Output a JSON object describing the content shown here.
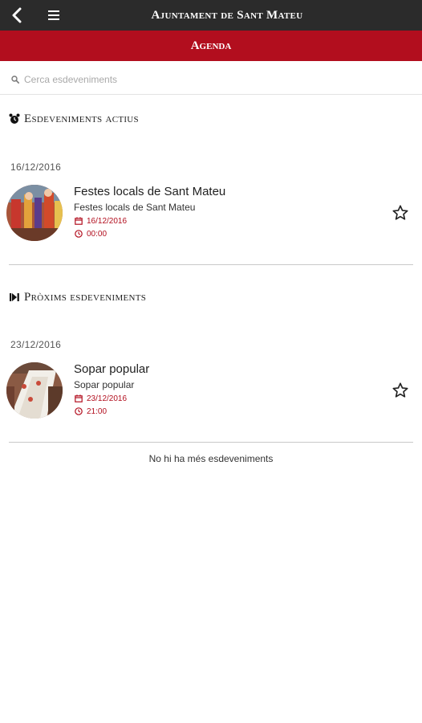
{
  "header": {
    "title": "Ajuntament de Sant Mateu",
    "section": "Agenda",
    "back_icon": "chevron-left-icon",
    "menu_icon": "hamburger-menu-icon"
  },
  "colors": {
    "topbar": "#2b2b2b",
    "accent": "#b20e1e"
  },
  "search": {
    "placeholder": "Cerca esdeveniments",
    "value": ""
  },
  "groups": [
    {
      "title": "Esdeveniments actius",
      "icon": "alarm-clock-icon",
      "date": "16/12/2016",
      "events": [
        {
          "title": "Festes locals de Sant Mateu",
          "subtitle": "Festes locals de Sant Mateu",
          "date": "16/12/2016",
          "time": "00:00",
          "image": "festival-photo",
          "starred": false
        }
      ]
    },
    {
      "title": "Pròxims esdeveniments",
      "icon": "next-track-icon",
      "date": "23/12/2016",
      "events": [
        {
          "title": "Sopar popular",
          "subtitle": "Sopar popular",
          "date": "23/12/2016",
          "time": "21:00",
          "image": "dinner-photo",
          "starred": false
        }
      ]
    }
  ],
  "footer": {
    "end_text": "No hi ha més esdeveniments"
  }
}
